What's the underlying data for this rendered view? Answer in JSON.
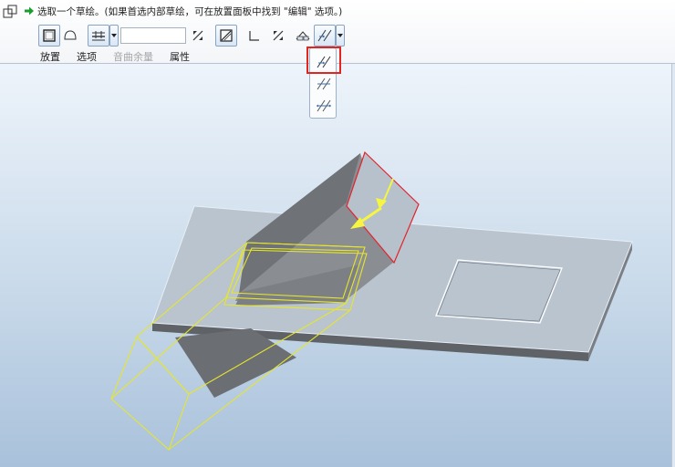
{
  "prompt": {
    "message": "选取一个草绘。(如果首选内部草绘，可在放置面板中找到 \"编辑\" 选项。)",
    "icon": "green-arrow-icon"
  },
  "toolbar": {
    "depth_value": "",
    "buttons": [
      "extrude-solid-icon",
      "extrude-surface-icon",
      "depth-option-icon",
      "depth-dropdown-icon",
      "flip-direction-icon",
      "remove-material-icon",
      "thicken-icon",
      "flip-side-icon",
      "taper-icon",
      "material-side-icon",
      "material-side-dropdown-icon"
    ]
  },
  "tabs": [
    {
      "label": "放置",
      "enabled": true
    },
    {
      "label": "选项",
      "enabled": true
    },
    {
      "label": "音曲余量",
      "enabled": false
    },
    {
      "label": "属性",
      "enabled": true
    }
  ],
  "dropdown": {
    "items": [
      "material-side-one-icon",
      "material-side-two-icon",
      "material-side-both-icon"
    ],
    "selected_index": 0
  },
  "colors": {
    "accent_highlight": "#e0261f",
    "sketch_yellow": "#e6e62a",
    "direction_arrow": "#f5f542",
    "plate": "#b9c4cf",
    "cut_body": "#7d8086"
  }
}
